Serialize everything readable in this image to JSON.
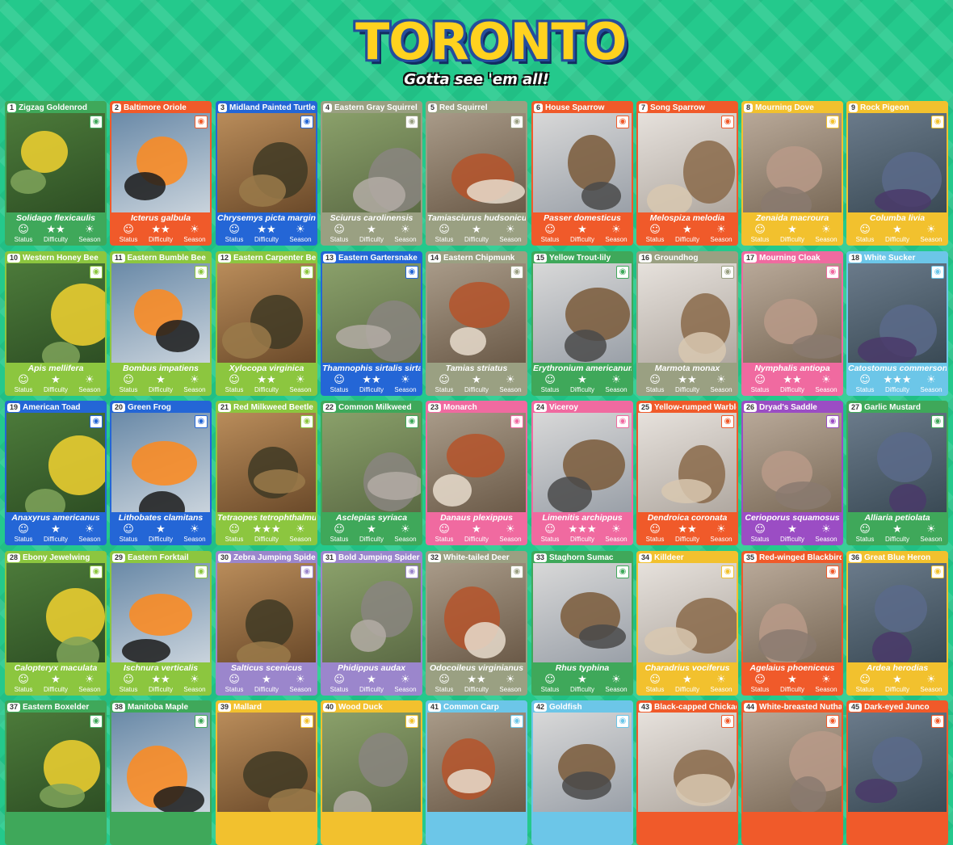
{
  "header": {
    "logo": "TORONTO",
    "tagline": "Gotta see 'em all!"
  },
  "labels": {
    "status": "Status",
    "difficulty": "Difficulty",
    "season": "Season"
  },
  "icons": {
    "status": "face-icon",
    "difficulty": "star-icon",
    "season": "sun-or-sprout-icon",
    "view": "eye-icon"
  },
  "cards": [
    {
      "n": "1",
      "name": "Zigzag Goldenrod",
      "sci": "Solidago flexicaulis",
      "color": "#3fa85a",
      "stars": "★★"
    },
    {
      "n": "2",
      "name": "Baltimore Oriole",
      "sci": "Icterus galbula",
      "color": "#f05a2a",
      "stars": "★★"
    },
    {
      "n": "3",
      "name": "Midland Painted Turtle",
      "sci": "Chrysemys picta marginata",
      "color": "#2466d6",
      "stars": "★★"
    },
    {
      "n": "4",
      "name": "Eastern Gray Squirrel",
      "sci": "Sciurus carolinensis",
      "color": "#9aa082",
      "stars": "★"
    },
    {
      "n": "5",
      "name": "Red Squirrel",
      "sci": "Tamiasciurus hudsonicus",
      "color": "#9aa082",
      "stars": "★"
    },
    {
      "n": "6",
      "name": "House Sparrow",
      "sci": "Passer domesticus",
      "color": "#f05a2a",
      "stars": "★"
    },
    {
      "n": "7",
      "name": "Song Sparrow",
      "sci": "Melospiza melodia",
      "color": "#f05a2a",
      "stars": "★"
    },
    {
      "n": "8",
      "name": "Mourning Dove",
      "sci": "Zenaida macroura",
      "color": "#f2c12e",
      "stars": "★"
    },
    {
      "n": "9",
      "name": "Rock Pigeon",
      "sci": "Columba livia",
      "color": "#f2c12e",
      "stars": "★"
    },
    {
      "n": "10",
      "name": "Western Honey Bee",
      "sci": "Apis mellifera",
      "color": "#8cc63f",
      "stars": "★"
    },
    {
      "n": "11",
      "name": "Eastern Bumble Bee",
      "sci": "Bombus impatiens",
      "color": "#8cc63f",
      "stars": "★"
    },
    {
      "n": "12",
      "name": "Eastern Carpenter Bee",
      "sci": "Xylocopa virginica",
      "color": "#8cc63f",
      "stars": "★★"
    },
    {
      "n": "13",
      "name": "Eastern Gartersnake",
      "sci": "Thamnophis sirtalis sirtalis",
      "color": "#2466d6",
      "stars": "★★"
    },
    {
      "n": "14",
      "name": "Eastern Chipmunk",
      "sci": "Tamias striatus",
      "color": "#9aa082",
      "stars": "★"
    },
    {
      "n": "15",
      "name": "Yellow Trout-lily",
      "sci": "Erythronium americanum",
      "color": "#3fa85a",
      "stars": "★"
    },
    {
      "n": "16",
      "name": "Groundhog",
      "sci": "Marmota monax",
      "color": "#9aa082",
      "stars": "★★"
    },
    {
      "n": "17",
      "name": "Mourning Cloak",
      "sci": "Nymphalis antiopa",
      "color": "#f06aa0",
      "stars": "★★"
    },
    {
      "n": "18",
      "name": "White Sucker",
      "sci": "Catostomus commersonii",
      "color": "#6cc6e8",
      "stars": "★★★"
    },
    {
      "n": "19",
      "name": "American Toad",
      "sci": "Anaxyrus americanus",
      "color": "#2466d6",
      "stars": "★"
    },
    {
      "n": "20",
      "name": "Green Frog",
      "sci": "Lithobates clamitans",
      "color": "#2466d6",
      "stars": "★"
    },
    {
      "n": "21",
      "name": "Red Milkweed Beetle",
      "sci": "Tetraopes tetrophthalmus",
      "color": "#8cc63f",
      "stars": "★★★"
    },
    {
      "n": "22",
      "name": "Common Milkweed",
      "sci": "Asclepias syriaca",
      "color": "#3fa85a",
      "stars": "★"
    },
    {
      "n": "23",
      "name": "Monarch",
      "sci": "Danaus plexippus",
      "color": "#f06aa0",
      "stars": "★"
    },
    {
      "n": "24",
      "name": "Viceroy",
      "sci": "Limenitis archippus",
      "color": "#f06aa0",
      "stars": "★★★"
    },
    {
      "n": "25",
      "name": "Yellow-rumped Warbler",
      "sci": "Dendroica coronata",
      "color": "#f05a2a",
      "stars": "★★"
    },
    {
      "n": "26",
      "name": "Dryad's Saddle",
      "sci": "Cerioporus squamosus",
      "color": "#9b4dc4",
      "stars": "★"
    },
    {
      "n": "27",
      "name": "Garlic Mustard",
      "sci": "Alliaria petiolata",
      "color": "#3fa85a",
      "stars": "★"
    },
    {
      "n": "28",
      "name": "Ebony Jewelwing",
      "sci": "Calopteryx maculata",
      "color": "#8cc63f",
      "stars": "★"
    },
    {
      "n": "29",
      "name": "Eastern Forktail",
      "sci": "Ischnura verticalis",
      "color": "#8cc63f",
      "stars": "★★"
    },
    {
      "n": "30",
      "name": "Zebra Jumping Spider",
      "sci": "Salticus scenicus",
      "color": "#9b86cc",
      "stars": "★"
    },
    {
      "n": "31",
      "name": "Bold Jumping Spider",
      "sci": "Phidippus audax",
      "color": "#9b86cc",
      "stars": "★"
    },
    {
      "n": "32",
      "name": "White-tailed Deer",
      "sci": "Odocoileus virginianus",
      "color": "#9aa082",
      "stars": "★★"
    },
    {
      "n": "33",
      "name": "Staghorn Sumac",
      "sci": "Rhus typhina",
      "color": "#3fa85a",
      "stars": "★"
    },
    {
      "n": "34",
      "name": "Killdeer",
      "sci": "Charadrius vociferus",
      "color": "#f2c12e",
      "stars": "★"
    },
    {
      "n": "35",
      "name": "Red-winged Blackbird",
      "sci": "Agelaius phoeniceus",
      "color": "#f05a2a",
      "stars": "★"
    },
    {
      "n": "36",
      "name": "Great Blue Heron",
      "sci": "Ardea herodias",
      "color": "#f2c12e",
      "stars": "★"
    },
    {
      "n": "37",
      "name": "Eastern Boxelder",
      "sci": "",
      "color": "#3fa85a",
      "stars": ""
    },
    {
      "n": "38",
      "name": "Manitoba Maple",
      "sci": "",
      "color": "#3fa85a",
      "stars": ""
    },
    {
      "n": "39",
      "name": "Mallard",
      "sci": "",
      "color": "#f2c12e",
      "stars": ""
    },
    {
      "n": "40",
      "name": "Wood Duck",
      "sci": "",
      "color": "#f2c12e",
      "stars": ""
    },
    {
      "n": "41",
      "name": "Common Carp",
      "sci": "",
      "color": "#6cc6e8",
      "stars": ""
    },
    {
      "n": "42",
      "name": "Goldfish",
      "sci": "",
      "color": "#6cc6e8",
      "stars": ""
    },
    {
      "n": "43",
      "name": "Black-capped Chickadee",
      "sci": "",
      "color": "#f05a2a",
      "stars": ""
    },
    {
      "n": "44",
      "name": "White-breasted Nuthatch",
      "sci": "",
      "color": "#f05a2a",
      "stars": ""
    },
    {
      "n": "45",
      "name": "Dark-eyed Junco",
      "sci": "",
      "color": "#f05a2a",
      "stars": ""
    }
  ]
}
